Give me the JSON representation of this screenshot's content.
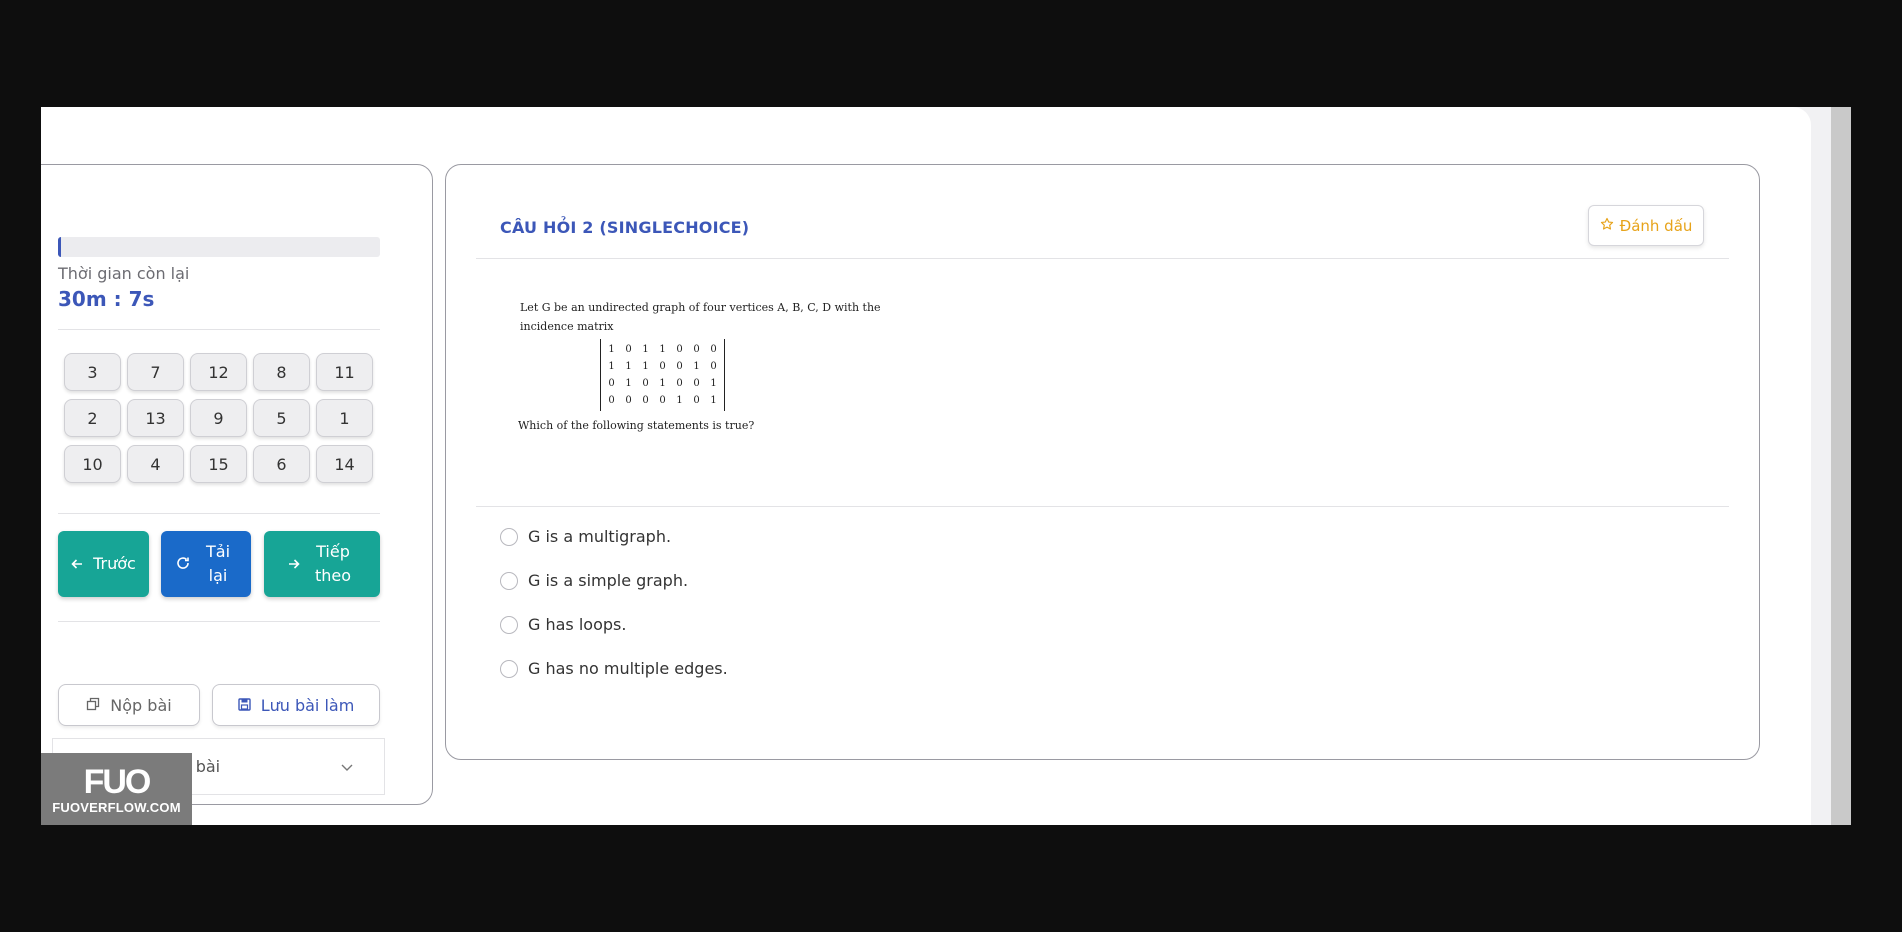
{
  "sidebar": {
    "progress_fraction": 0.01,
    "time_label": "Thời gian còn lại",
    "time_value": "30m : 7s",
    "question_numbers": [
      "3",
      "7",
      "12",
      "8",
      "11",
      "2",
      "13",
      "9",
      "5",
      "1",
      "10",
      "4",
      "15",
      "6",
      "14"
    ],
    "prev_label": "Trước",
    "reload_label": "Tải lại",
    "next_label": "Tiếp theo",
    "submit_label": "Nộp bài",
    "save_label": "Lưu bài làm",
    "notes_label": "Lưu ý khi làm bài"
  },
  "question": {
    "title": "CÂU HỎI 2 (SINGLECHOICE)",
    "mark_label": "Đánh dấu",
    "text_line1": "Let G be an undirected graph of four vertices A, B, C, D with the",
    "text_line2": "incidence matrix",
    "matrix": [
      [
        "1",
        "0",
        "1",
        "1",
        "0",
        "0",
        "0"
      ],
      [
        "1",
        "1",
        "1",
        "0",
        "0",
        "1",
        "0"
      ],
      [
        "0",
        "1",
        "0",
        "1",
        "0",
        "0",
        "1"
      ],
      [
        "0",
        "0",
        "0",
        "0",
        "1",
        "0",
        "1"
      ]
    ],
    "text_line3": "Which of the following statements is true?",
    "options": [
      "G is a multigraph.",
      "G is a simple graph.",
      "G has loops.",
      "G has no multiple edges."
    ]
  },
  "watermark": {
    "logo": "FUO",
    "text": "FUOVERFLOW.COM"
  },
  "colors": {
    "accent": "#3c57b8",
    "teal": "#17a596",
    "blue": "#1a6ac9",
    "mark": "#e7a31a"
  }
}
